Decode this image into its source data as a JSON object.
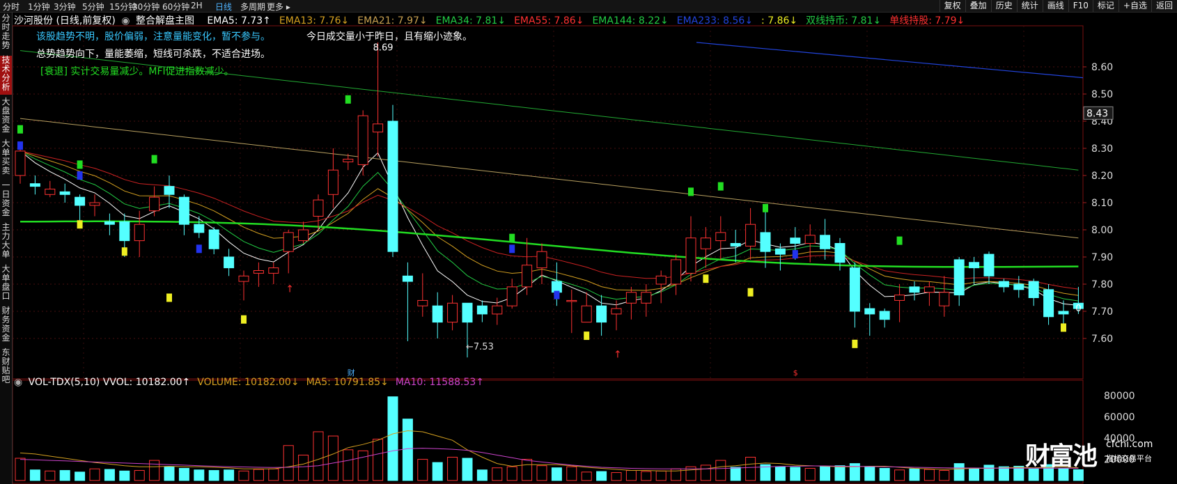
{
  "toolbar": {
    "left_tabs": [
      "分时",
      "1分钟",
      "3分钟",
      "5分钟",
      "15分钟",
      "30分钟",
      "60分钟",
      "2H",
      "日线",
      "多周期",
      "更多 ▸"
    ],
    "active_tab": "日线",
    "right_buttons": [
      "复权",
      "叠加",
      "历史",
      "统计",
      "画线",
      "F10",
      "标记",
      "+自选",
      "返回"
    ]
  },
  "sidebar": {
    "items": [
      "分时走势",
      "技术分析",
      "大盘资金",
      "大单买卖",
      "一日资金",
      "主力大单",
      "大单盘口",
      "财务资金",
      "东财贴吧"
    ],
    "active": "技术分析"
  },
  "stock_title": "沙河股份 (日线,前复权)",
  "indicator_name": "整合解盘主图",
  "ema_labels": [
    {
      "text": "EMA5: 7.73↑",
      "color": "#ffffff"
    },
    {
      "text": "EMA13: 7.76↓",
      "color": "#d4a020"
    },
    {
      "text": "EMA21: 7.97↓",
      "color": "#c8a050"
    },
    {
      "text": "EMA34: 7.81↓",
      "color": "#22cc44"
    },
    {
      "text": "EMA55: 7.86↓",
      "color": "#ff3030"
    },
    {
      "text": "EMA144: 8.22↓",
      "color": "#22cc44"
    },
    {
      "text": "EMA233: 8.56↓",
      "color": "#2244dd"
    },
    {
      "text": ": 7.86↓",
      "color": "#eeee22"
    },
    {
      "text": "双线持币: 7.81↓",
      "color": "#22cc44"
    },
    {
      "text": "单线持股: 7.79↓",
      "color": "#ff3030"
    }
  ],
  "annotations": {
    "line1": "该股趋势不明，股价偏弱，注意量能变化，暂不参与。",
    "line1b": "今日成交量小于昨日，且有缩小迹象。",
    "line2": "总势趋势向下，量能萎缩，短线可杀跌，不适合进场。",
    "line3": "[衰退] 实计交易量减少。MFI促进指数减少。"
  },
  "price_axis": {
    "labels": [
      "8.60",
      "8.50",
      "8.40",
      "8.30",
      "8.20",
      "8.10",
      "8.00",
      "7.90",
      "7.80",
      "7.70",
      "7.60"
    ],
    "current": "8.43"
  },
  "markers": {
    "high": "8.69",
    "low": "←7.53",
    "zero": "0",
    "cai": "财",
    "s_mark": "$"
  },
  "volume_header": [
    {
      "text": "VOL-TDX(5,10) VVOL: 10182.00↑",
      "color": "#ffffff"
    },
    {
      "text": "VOLUME: 10182.00↓",
      "color": "#d4a020"
    },
    {
      "text": "MA5: 10791.85↓",
      "color": "#d4a020"
    },
    {
      "text": "MA10: 11588.53↑",
      "color": "#cc44cc"
    }
  ],
  "volume_axis": [
    "80000",
    "60000",
    "40000",
    "20000"
  ],
  "watermark": {
    "brand": "财富池",
    "url": "cfchi.com",
    "slogan": "指标交易平台"
  },
  "colors": {
    "up": "#ff3232",
    "down": "#54ffff",
    "ema5": "#ffffff",
    "ema13": "#d4a020",
    "ema21": "#c8a050",
    "ema34": "#22cc44",
    "ema55": "#ff3030",
    "ema144": "#22cc44",
    "ema233": "#2244dd"
  },
  "chart_data": {
    "type": "candlestick",
    "candles": [
      [
        8.2,
        8.29,
        8.17,
        8.3
      ],
      [
        8.17,
        8.16,
        8.13,
        8.2
      ],
      [
        8.13,
        8.15,
        8.12,
        8.18
      ],
      [
        8.14,
        8.13,
        8.1,
        8.17
      ],
      [
        8.12,
        8.09,
        8.02,
        8.13
      ],
      [
        8.09,
        8.1,
        8.05,
        8.13
      ],
      [
        8.03,
        8.02,
        7.98,
        8.06
      ],
      [
        8.03,
        7.96,
        7.9,
        8.06
      ],
      [
        7.96,
        8.02,
        7.9,
        8.07
      ],
      [
        8.07,
        8.12,
        8.05,
        8.16
      ],
      [
        8.16,
        8.13,
        8.08,
        8.2
      ],
      [
        8.12,
        8.02,
        7.98,
        8.13
      ],
      [
        8.02,
        7.99,
        7.97,
        8.05
      ],
      [
        8.0,
        7.93,
        7.91,
        8.01
      ],
      [
        7.9,
        7.86,
        7.83,
        7.93
      ],
      [
        7.81,
        7.83,
        7.74,
        7.85
      ],
      [
        7.84,
        7.85,
        7.79,
        7.88
      ],
      [
        7.84,
        7.86,
        7.8,
        7.88
      ],
      [
        7.92,
        7.99,
        7.84,
        8.0
      ],
      [
        7.96,
        8.0,
        7.95,
        8.03
      ],
      [
        8.05,
        8.11,
        8.0,
        8.13
      ],
      [
        8.13,
        8.22,
        8.08,
        8.3
      ],
      [
        8.25,
        8.26,
        8.22,
        8.28
      ],
      [
        8.24,
        8.42,
        8.2,
        8.44
      ],
      [
        8.36,
        8.39,
        8.27,
        8.69
      ],
      [
        8.4,
        7.92,
        7.9,
        8.46
      ],
      [
        7.83,
        7.81,
        7.59,
        7.88
      ],
      [
        7.72,
        7.74,
        7.68,
        7.84
      ],
      [
        7.72,
        7.66,
        7.6,
        7.77
      ],
      [
        7.66,
        7.73,
        7.63,
        7.76
      ],
      [
        7.73,
        7.66,
        7.53,
        7.73
      ],
      [
        7.72,
        7.69,
        7.66,
        7.74
      ],
      [
        7.69,
        7.72,
        7.65,
        7.75
      ],
      [
        7.72,
        7.79,
        7.71,
        7.82
      ],
      [
        7.79,
        7.87,
        7.76,
        7.97
      ],
      [
        7.86,
        7.92,
        7.8,
        7.95
      ],
      [
        7.81,
        7.77,
        7.72,
        7.88
      ],
      [
        7.74,
        7.74,
        7.62,
        7.78
      ],
      [
        7.66,
        7.72,
        7.67,
        7.77
      ],
      [
        7.72,
        7.66,
        7.61,
        7.76
      ],
      [
        7.69,
        7.71,
        7.63,
        7.74
      ],
      [
        7.73,
        7.77,
        7.67,
        7.79
      ],
      [
        7.73,
        7.77,
        7.68,
        7.8
      ],
      [
        7.8,
        7.83,
        7.73,
        7.85
      ],
      [
        7.8,
        7.89,
        7.76,
        7.91
      ],
      [
        7.84,
        7.97,
        7.81,
        8.05
      ],
      [
        7.93,
        7.97,
        7.86,
        8.01
      ],
      [
        7.96,
        7.99,
        7.89,
        8.05
      ],
      [
        7.95,
        7.94,
        7.88,
        8.0
      ],
      [
        7.94,
        8.02,
        7.89,
        8.08
      ],
      [
        7.99,
        7.92,
        7.86,
        8.09
      ],
      [
        7.93,
        7.91,
        7.85,
        7.95
      ],
      [
        7.97,
        7.95,
        7.89,
        8.01
      ],
      [
        7.95,
        7.98,
        7.88,
        8.02
      ],
      [
        7.98,
        7.93,
        7.89,
        8.04
      ],
      [
        7.95,
        7.88,
        7.85,
        7.97
      ],
      [
        7.86,
        7.7,
        7.64,
        7.88
      ],
      [
        7.71,
        7.69,
        7.61,
        7.73
      ],
      [
        7.7,
        7.67,
        7.64,
        7.71
      ],
      [
        7.74,
        7.76,
        7.66,
        7.8
      ],
      [
        7.79,
        7.77,
        7.74,
        7.81
      ],
      [
        7.77,
        7.79,
        7.72,
        7.81
      ],
      [
        7.72,
        7.77,
        7.68,
        7.83
      ],
      [
        7.89,
        7.76,
        7.72,
        7.9
      ],
      [
        7.88,
        7.86,
        7.8,
        7.9
      ],
      [
        7.91,
        7.83,
        7.8,
        7.92
      ],
      [
        7.81,
        7.79,
        7.77,
        7.82
      ],
      [
        7.8,
        7.78,
        7.75,
        7.83
      ],
      [
        7.81,
        7.75,
        7.72,
        7.82
      ],
      [
        7.78,
        7.68,
        7.65,
        7.8
      ],
      [
        7.7,
        7.69,
        7.63,
        7.74
      ],
      [
        7.73,
        7.71,
        7.69,
        7.79
      ]
    ],
    "volume": [
      21000,
      10000,
      9000,
      9500,
      8000,
      11000,
      10500,
      9000,
      9500,
      19000,
      13000,
      11500,
      10000,
      9500,
      10000,
      9000,
      10500,
      11000,
      33000,
      24000,
      46000,
      42000,
      29000,
      28000,
      39000,
      79000,
      58000,
      20000,
      17000,
      22000,
      21000,
      10000,
      12000,
      13000,
      20000,
      14000,
      12000,
      13000,
      8000,
      8500,
      7500,
      9500,
      8500,
      9000,
      11000,
      13000,
      14500,
      19000,
      12500,
      22000,
      15000,
      13000,
      12500,
      11500,
      13500,
      14000,
      16000,
      13000,
      11500,
      10000,
      11000,
      10500,
      9500,
      16000,
      11000,
      14500,
      13000,
      13500,
      11000,
      15000,
      11500,
      10182
    ],
    "ma5": [
      26000,
      25000,
      23000,
      21000,
      19000,
      17000,
      15500,
      14000,
      13000,
      13000,
      13500,
      13000,
      13000,
      12500,
      12000,
      11000,
      11000,
      11000,
      13000,
      15500,
      20000,
      25000,
      31000,
      34000,
      38000,
      44000,
      47000,
      46000,
      42000,
      38000,
      29000,
      22000,
      16000,
      13500,
      15000,
      15000,
      15000,
      14000,
      12500,
      11500,
      10500,
      9500,
      9500,
      9000,
      9000,
      10000,
      11000,
      13000,
      14000,
      15500,
      16500,
      16000,
      14500,
      14000,
      13500,
      13000,
      13000,
      13500,
      13500,
      12500,
      11500,
      11000,
      10500,
      11000,
      11500,
      11500,
      12000,
      12500,
      12000,
      12500,
      13000,
      12000
    ],
    "ma10": [
      20000,
      19500,
      19000,
      18500,
      18000,
      17500,
      17000,
      16500,
      16000,
      15500,
      15000,
      14500,
      14000,
      13500,
      13000,
      12800,
      12500,
      12300,
      12500,
      13000,
      14000,
      16500,
      19000,
      22000,
      25000,
      28000,
      30000,
      30500,
      30000,
      29500,
      28500,
      26500,
      24000,
      21500,
      19000,
      17500,
      16000,
      14500,
      13500,
      12500,
      12000,
      11500,
      11200,
      11000,
      11000,
      11000,
      11000,
      11300,
      11800,
      12300,
      12800,
      13300,
      13500,
      13800,
      13800,
      13500,
      13300,
      13200,
      13000,
      12800,
      12500,
      12200,
      12000,
      11800,
      11800,
      11700,
      11700,
      11600,
      11600,
      11600,
      11600,
      11588
    ]
  }
}
